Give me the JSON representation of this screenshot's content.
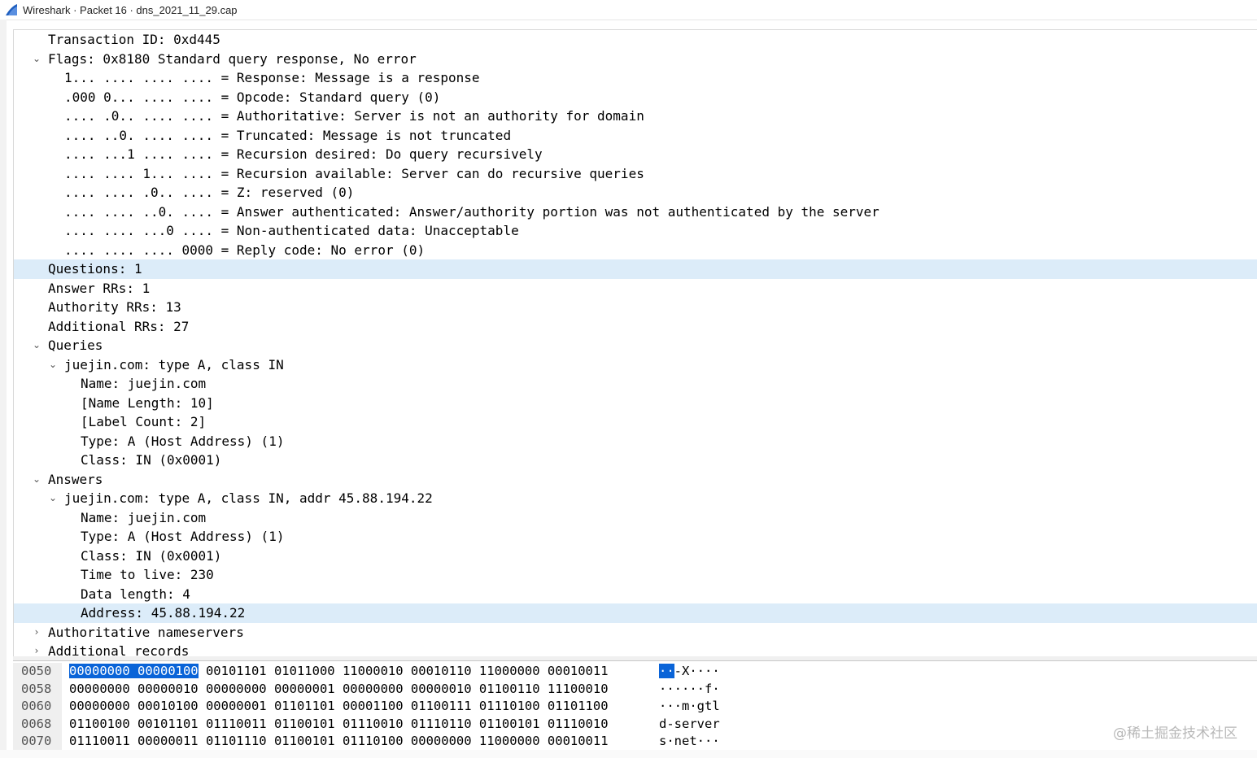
{
  "window": {
    "title": "Wireshark · Packet 16 · dns_2021_11_29.cap"
  },
  "tree": [
    {
      "indent": 0,
      "caret": "",
      "text": "Transaction ID: 0xd445"
    },
    {
      "indent": 0,
      "caret": "expanded",
      "text": "Flags: 0x8180 Standard query response, No error"
    },
    {
      "indent": 1,
      "caret": "",
      "text": "1... .... .... .... = Response: Message is a response"
    },
    {
      "indent": 1,
      "caret": "",
      "text": ".000 0... .... .... = Opcode: Standard query (0)"
    },
    {
      "indent": 1,
      "caret": "",
      "text": ".... .0.. .... .... = Authoritative: Server is not an authority for domain"
    },
    {
      "indent": 1,
      "caret": "",
      "text": ".... ..0. .... .... = Truncated: Message is not truncated"
    },
    {
      "indent": 1,
      "caret": "",
      "text": ".... ...1 .... .... = Recursion desired: Do query recursively"
    },
    {
      "indent": 1,
      "caret": "",
      "text": ".... .... 1... .... = Recursion available: Server can do recursive queries"
    },
    {
      "indent": 1,
      "caret": "",
      "text": ".... .... .0.. .... = Z: reserved (0)"
    },
    {
      "indent": 1,
      "caret": "",
      "text": ".... .... ..0. .... = Answer authenticated: Answer/authority portion was not authenticated by the server"
    },
    {
      "indent": 1,
      "caret": "",
      "text": ".... .... ...0 .... = Non-authenticated data: Unacceptable"
    },
    {
      "indent": 1,
      "caret": "",
      "text": ".... .... .... 0000 = Reply code: No error (0)"
    },
    {
      "indent": 0,
      "caret": "",
      "text": "Questions: 1",
      "selected": true
    },
    {
      "indent": 0,
      "caret": "",
      "text": "Answer RRs: 1"
    },
    {
      "indent": 0,
      "caret": "",
      "text": "Authority RRs: 13"
    },
    {
      "indent": 0,
      "caret": "",
      "text": "Additional RRs: 27"
    },
    {
      "indent": 0,
      "caret": "expanded",
      "text": "Queries"
    },
    {
      "indent": 1,
      "caret": "expanded",
      "text": "juejin.com: type A, class IN"
    },
    {
      "indent": 2,
      "caret": "",
      "text": "Name: juejin.com"
    },
    {
      "indent": 2,
      "caret": "",
      "text": "[Name Length: 10]"
    },
    {
      "indent": 2,
      "caret": "",
      "text": "[Label Count: 2]"
    },
    {
      "indent": 2,
      "caret": "",
      "text": "Type: A (Host Address) (1)"
    },
    {
      "indent": 2,
      "caret": "",
      "text": "Class: IN (0x0001)"
    },
    {
      "indent": 0,
      "caret": "expanded",
      "text": "Answers"
    },
    {
      "indent": 1,
      "caret": "expanded",
      "text": "juejin.com: type A, class IN, addr 45.88.194.22"
    },
    {
      "indent": 2,
      "caret": "",
      "text": "Name: juejin.com"
    },
    {
      "indent": 2,
      "caret": "",
      "text": "Type: A (Host Address) (1)"
    },
    {
      "indent": 2,
      "caret": "",
      "text": "Class: IN (0x0001)"
    },
    {
      "indent": 2,
      "caret": "",
      "text": "Time to live: 230"
    },
    {
      "indent": 2,
      "caret": "",
      "text": "Data length: 4"
    },
    {
      "indent": 2,
      "caret": "",
      "text": "Address: 45.88.194.22",
      "selected": true
    },
    {
      "indent": 0,
      "caret": "collapsed",
      "text": "Authoritative nameservers"
    },
    {
      "indent": 0,
      "caret": "collapsed",
      "text": "Additional records"
    }
  ],
  "bytes": [
    {
      "offset": "0050",
      "hl": "00000000 00000100",
      "hex": " 00101101 01011000 11000010 00010110 11000000 00010011",
      "asc_hl": "··",
      "asc": "-X····"
    },
    {
      "offset": "0058",
      "hl": "",
      "hex": "00000000 00000010 00000000 00000001 00000000 00000010 01100110 11100010",
      "asc_hl": "",
      "asc": "······f·"
    },
    {
      "offset": "0060",
      "hl": "",
      "hex": "00000000 00010100 00000001 01101101 00001100 01100111 01110100 01101100",
      "asc_hl": "",
      "asc": "···m·gtl"
    },
    {
      "offset": "0068",
      "hl": "",
      "hex": "01100100 00101101 01110011 01100101 01110010 01110110 01100101 01110010",
      "asc_hl": "",
      "asc": "d-server"
    },
    {
      "offset": "0070",
      "hl": "",
      "hex": "01110011 00000011 01101110 01100101 01110100 00000000 11000000 00010011",
      "asc_hl": "",
      "asc": "s·net···"
    }
  ],
  "watermark": "@稀土掘金技术社区",
  "colors": {
    "selected_row": "#dcecf9",
    "byte_highlight": "#0a64d8",
    "logo_blue": "#1f5fbf"
  }
}
